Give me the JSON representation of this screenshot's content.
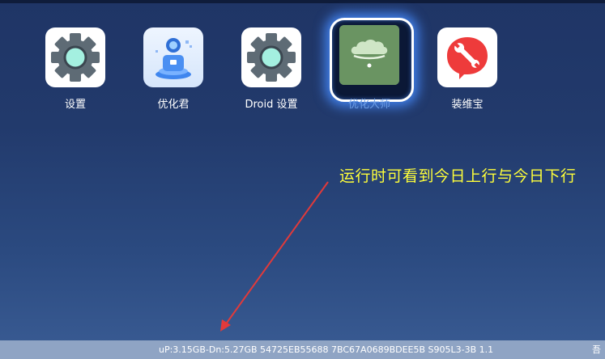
{
  "apps": [
    {
      "label": "设置",
      "icon": "settings-gear-icon"
    },
    {
      "label": "优化君",
      "icon": "optimizer-robot-icon"
    },
    {
      "label": "Droid 设置",
      "icon": "droid-settings-gear-icon"
    },
    {
      "label": "优化大师",
      "icon": "cloud-optimizer-icon",
      "focused": true
    },
    {
      "label": "装维宝",
      "icon": "wrench-tool-icon"
    }
  ],
  "annotation": {
    "text": "运行时可看到今日上行与今日下行",
    "color": "#ffff3a"
  },
  "status_bar": {
    "text": "uP:3.15GB-Dn:5.27GB  54725EB55688 7BC67A0689BDEE5B S905L3-3B 1.1",
    "corner": "吾"
  },
  "colors": {
    "background_top": "#1f3566",
    "background_bottom": "#3a5c94",
    "focus_glow": "#468cff",
    "focused_label": "#6f9fe6",
    "status_bar": "#8fa4c4"
  }
}
